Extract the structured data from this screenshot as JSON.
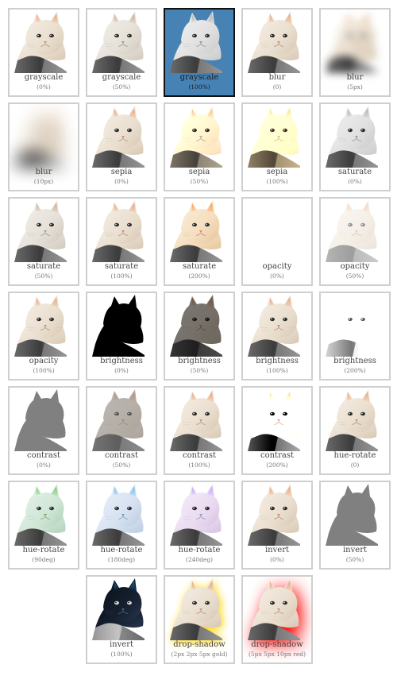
{
  "cells": [
    {
      "name": "grayscale",
      "value": "(0%)",
      "css": "grayscale(0%)",
      "selected": false
    },
    {
      "name": "grayscale",
      "value": "(50%)",
      "css": "grayscale(50%)",
      "selected": false
    },
    {
      "name": "grayscale",
      "value": "(100%)",
      "css": "grayscale(100%)",
      "selected": true
    },
    {
      "name": "blur",
      "value": "(0)",
      "css": "blur(0)",
      "selected": false
    },
    {
      "name": "blur",
      "value": "(5px)",
      "css": "blur(5px)",
      "selected": false
    },
    {
      "name": "blur",
      "value": "(10px)",
      "css": "blur(10px)",
      "selected": false
    },
    {
      "name": "sepia",
      "value": "(0%)",
      "css": "sepia(0%)",
      "selected": false
    },
    {
      "name": "sepia",
      "value": "(50%)",
      "css": "sepia(50%)",
      "selected": false
    },
    {
      "name": "sepia",
      "value": "(100%)",
      "css": "sepia(100%)",
      "selected": false
    },
    {
      "name": "saturate",
      "value": "(0%)",
      "css": "saturate(0%)",
      "selected": false
    },
    {
      "name": "saturate",
      "value": "(50%)",
      "css": "saturate(50%)",
      "selected": false
    },
    {
      "name": "saturate",
      "value": "(100%)",
      "css": "saturate(100%)",
      "selected": false
    },
    {
      "name": "saturate",
      "value": "(200%)",
      "css": "saturate(200%)",
      "selected": false
    },
    {
      "name": "opacity",
      "value": "(0%)",
      "css": "opacity(0%)",
      "selected": false
    },
    {
      "name": "opacity",
      "value": "(50%)",
      "css": "opacity(50%)",
      "selected": false
    },
    {
      "name": "opacity",
      "value": "(100%)",
      "css": "opacity(100%)",
      "selected": false
    },
    {
      "name": "brightness",
      "value": "(0%)",
      "css": "brightness(0%)",
      "selected": false
    },
    {
      "name": "brightness",
      "value": "(50%)",
      "css": "brightness(50%)",
      "selected": false
    },
    {
      "name": "brightness",
      "value": "(100%)",
      "css": "brightness(100%)",
      "selected": false
    },
    {
      "name": "brightness",
      "value": "(200%)",
      "css": "brightness(200%)",
      "selected": false
    },
    {
      "name": "contrast",
      "value": "(0%)",
      "css": "contrast(0%)",
      "selected": false
    },
    {
      "name": "contrast",
      "value": "(50%)",
      "css": "contrast(50%)",
      "selected": false
    },
    {
      "name": "contrast",
      "value": "(100%)",
      "css": "contrast(100%)",
      "selected": false
    },
    {
      "name": "contrast",
      "value": "(200%)",
      "css": "contrast(200%)",
      "selected": false
    },
    {
      "name": "hue-rotate",
      "value": "(0)",
      "css": "hue-rotate(0deg)",
      "selected": false
    },
    {
      "name": "hue-rotate",
      "value": "(90deg)",
      "css": "hue-rotate(90deg)",
      "selected": false
    },
    {
      "name": "hue-rotate",
      "value": "(180deg)",
      "css": "hue-rotate(180deg)",
      "selected": false
    },
    {
      "name": "hue-rotate",
      "value": "(240deg)",
      "css": "hue-rotate(240deg)",
      "selected": false
    },
    {
      "name": "invert",
      "value": "(0%)",
      "css": "invert(0%)",
      "selected": false
    },
    {
      "name": "invert",
      "value": "(50%)",
      "css": "invert(50%)",
      "selected": false
    },
    {
      "name": "invert",
      "value": "(100%)",
      "css": "invert(100%)",
      "selected": false
    },
    {
      "name": "drop-shadow",
      "value": "(2px 2px 5px gold)",
      "css": "drop-shadow(2px 2px 5px gold)",
      "selected": false
    },
    {
      "name": "drop-shadow",
      "value": "(5px 5px 10px red)",
      "css": "drop-shadow(5px 5px 10px red)",
      "selected": false
    }
  ],
  "colors": {
    "selected_bg": "#4682b4",
    "border": "#cfcfcf",
    "selected_border": "#111111"
  }
}
